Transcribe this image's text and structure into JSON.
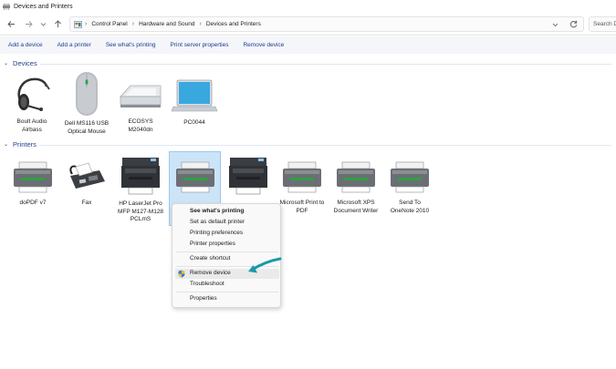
{
  "window": {
    "title": "Devices and Printers"
  },
  "address": {
    "breadcrumbs": [
      "Control Panel",
      "Hardware and Sound",
      "Devices and Printers"
    ],
    "search_placeholder": "Search Devices and Printers"
  },
  "commands": [
    "Add a device",
    "Add a printer",
    "See what's printing",
    "Print server properties",
    "Remove device"
  ],
  "groups": {
    "devices": {
      "title": "Devices",
      "items": [
        {
          "label": "Boult Audio\nAirbass",
          "icon": "headset-icon"
        },
        {
          "label": "Dell MS116 USB\nOptical Mouse",
          "icon": "mouse-icon"
        },
        {
          "label": "ECOSYS\nM2040dn",
          "icon": "scanner-icon"
        },
        {
          "label": "PC0044",
          "icon": "laptop-icon"
        }
      ]
    },
    "printers": {
      "title": "Printers",
      "items": [
        {
          "label": "doPDF v7",
          "icon": "printer-icon"
        },
        {
          "label": "Fax",
          "icon": "fax-icon"
        },
        {
          "label": "HP LaserJet Pro\nMFP M127-M128\nPCLmS",
          "icon": "mfp-printer-icon"
        },
        {
          "label": "",
          "icon": "printer-icon"
        },
        {
          "label": "",
          "icon": "mfp-printer-icon"
        },
        {
          "label": "Microsoft Print to\nPDF",
          "icon": "printer-icon"
        },
        {
          "label": "Microsoft XPS\nDocument Writer",
          "icon": "printer-icon"
        },
        {
          "label": "Send To\nOneNote 2010",
          "icon": "printer-icon"
        }
      ]
    }
  },
  "context_menu": {
    "items": [
      "See what's printing",
      "Set as default printer",
      "Printing preferences",
      "Printer properties",
      "Create shortcut",
      "Remove device",
      "Troubleshoot",
      "Properties"
    ]
  },
  "colors": {
    "accent": "#1f3a93",
    "selection": "#cce4f7",
    "arrow": "#1a9aa8"
  }
}
